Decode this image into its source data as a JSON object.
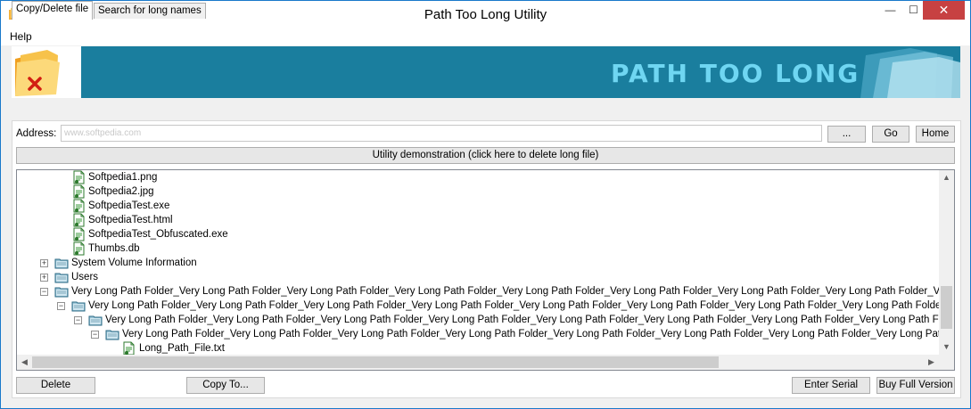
{
  "window": {
    "title": "Path Too Long Utility",
    "min_glyph": "—",
    "max_glyph": "☐",
    "close_glyph": "✕"
  },
  "menu": {
    "items": [
      "Help"
    ]
  },
  "banner": {
    "text": "PATH TOO LONG"
  },
  "tabs": [
    {
      "label": "Copy/Delete file",
      "active": true
    },
    {
      "label": "Search for long names",
      "active": false
    }
  ],
  "address": {
    "label": "Address:",
    "value": "www.softpedia.com"
  },
  "buttons": {
    "browse": "...",
    "go": "Go",
    "home": "Home",
    "demo": "Utility demonstration (click here to delete long file)",
    "delete": "Delete",
    "copy_to": "Copy To...",
    "enter_serial": "Enter Serial",
    "buy": "Buy Full Version"
  },
  "tree": [
    {
      "label": "Softpedia1.png",
      "type": "file"
    },
    {
      "label": "Softpedia2.jpg",
      "type": "file"
    },
    {
      "label": "SoftpediaTest.exe",
      "type": "file"
    },
    {
      "label": "SoftpediaTest.html",
      "type": "file"
    },
    {
      "label": "SoftpediaTest_Obfuscated.exe",
      "type": "file"
    },
    {
      "label": "Thumbs.db",
      "type": "file"
    },
    {
      "label": "System Volume Information",
      "type": "folder",
      "expander": "+"
    },
    {
      "label": "Users",
      "type": "folder",
      "expander": "+"
    },
    {
      "label": "Very Long Path Folder_Very Long Path Folder_Very Long Path Folder_Very Long Path Folder_Very Long Path Folder_Very Long Path Folder_Very Long Path Folder_Very Long Path Folder_Very Long Path Folder_Very Long Path Folder_Very Long Path Folder_Very Long Path Folder_Very Long Path F",
      "type": "folder",
      "expander": "−"
    },
    {
      "label": "Very Long Path Folder_Very Long Path Folder_Very Long Path Folder_Very Long Path Folder_Very Long Path Folder_Very Long Path Folder_Very Long Path Folder_Very Long Path Folder_Very Long Path Folder_Very Long Path Folder_Very Long Path Folder_Very Long Path Folder_Very Long Path Pa",
      "type": "folder",
      "expander": "−"
    },
    {
      "label": "Very Long Path Folder_Very Long Path Folder_Very Long Path Folder_Very Long Path Folder_Very Long Path Folder_Very Long Path Folder_Very Long Path Folder_Very Long Path Folder_Very Long Path Folder_Very Long Path Folder_Very Long Path Folder_Very Long Path Folder_Very Long Path Lon",
      "type": "folder",
      "expander": "−"
    },
    {
      "label": "Very Long Path Folder_Very Long Path Folder_Very Long Path Folder_Very Long Path Folder_Very Long Path Folder_Very Long Path Folder_Very Long Path Folder_Very Long Path Folder_Very Long Path Folder_Very Long Path Folder_Very Long Path Folder_Very Long Path Folder_Very Long Path Folder_Very Long",
      "type": "folder",
      "expander": "−"
    },
    {
      "label": "Long_Path_File.txt",
      "type": "file"
    }
  ],
  "colors": {
    "banner_bg": "#1a7e9e",
    "banner_text": "#6fd6f2",
    "close_button": "#c74142"
  }
}
